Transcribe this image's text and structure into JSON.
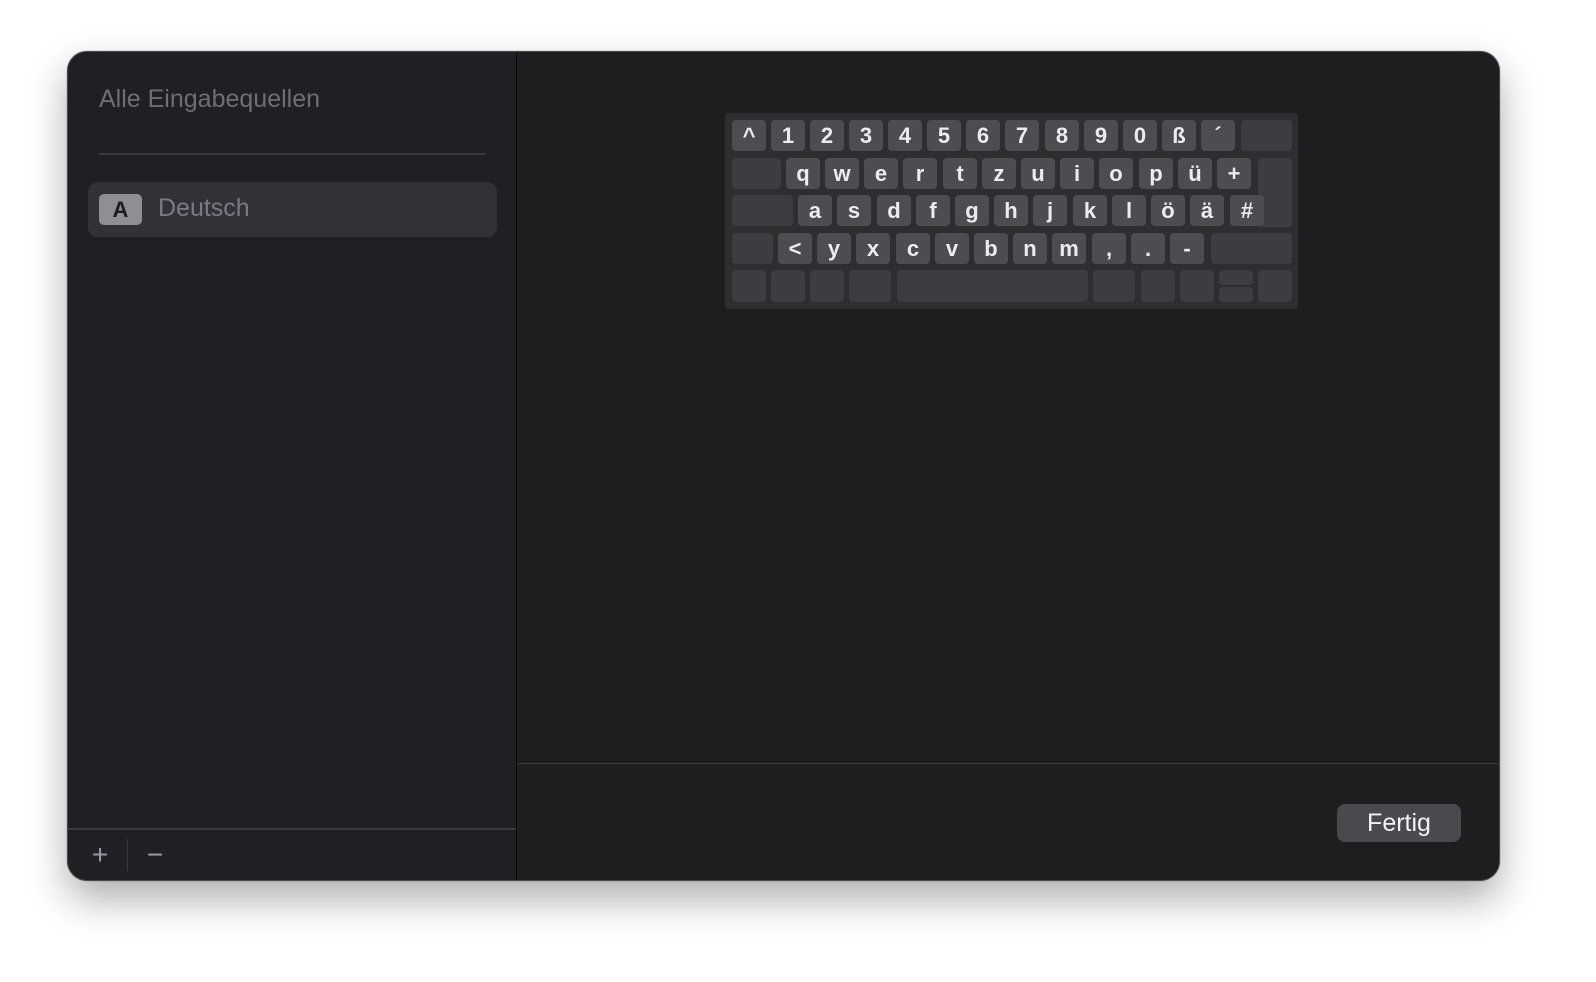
{
  "sidebar": {
    "title": "Alle Eingabequellen",
    "sources": [
      {
        "badge": "A",
        "label": "Deutsch",
        "selected": true
      }
    ],
    "add_label": "+",
    "remove_label": "−"
  },
  "keyboard": {
    "layout": "Deutsch",
    "rows": [
      [
        "^",
        "1",
        "2",
        "3",
        "4",
        "5",
        "6",
        "7",
        "8",
        "9",
        "0",
        "ß",
        "´"
      ],
      [
        "q",
        "w",
        "e",
        "r",
        "t",
        "z",
        "u",
        "i",
        "o",
        "p",
        "ü",
        "+"
      ],
      [
        "a",
        "s",
        "d",
        "f",
        "g",
        "h",
        "j",
        "k",
        "l",
        "ö",
        "ä",
        "#"
      ],
      [
        "<",
        "y",
        "x",
        "c",
        "v",
        "b",
        "n",
        "m",
        ",",
        ".",
        "-"
      ]
    ]
  },
  "footer": {
    "done_label": "Fertig"
  },
  "colors": {
    "window_bg": "#1f1f22",
    "key_bg": "#4d4d51",
    "key_text": "#ebebf0",
    "selection_bg": "#323236"
  }
}
